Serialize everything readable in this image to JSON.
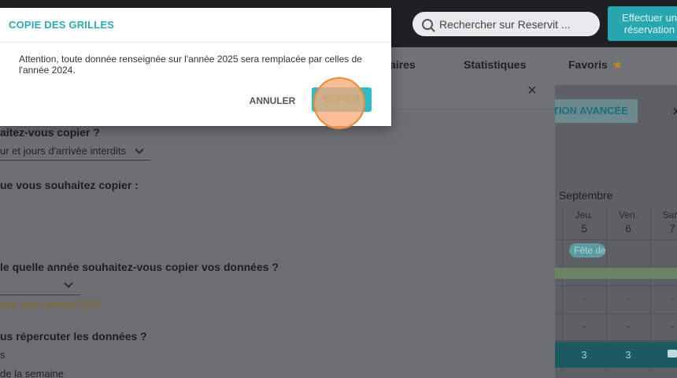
{
  "topbar": {
    "search_placeholder": "Rechercher sur Reservit ...",
    "reserve_label_line1": "Effectuer un",
    "reserve_label_line2": "réservation"
  },
  "nav": {
    "tab_tarifs": "aires",
    "tab_stats": "Statistiques",
    "tab_favoris": "Favoris",
    "star": "★"
  },
  "calendar": {
    "advanced_search": "TION AVANCÉE",
    "month": "Septembre",
    "days": [
      {
        "name": "Jeu.",
        "num": "5"
      },
      {
        "name": "Ven.",
        "num": "6"
      },
      {
        "name": "Sam",
        "num": "7"
      }
    ],
    "event": "Fête de",
    "dash": "-",
    "row_values": [
      "3",
      "3"
    ]
  },
  "main_dialog": {
    "close": "×",
    "q1": "aitez-vous copier ?",
    "a1": "ur et jours d'arrivée interdits",
    "q2": "ue vous souhaitez copier :",
    "q3": "le quelle année souhaitez-vous copier vos données ?",
    "note": "ées pour l'année 2025",
    "q4": "us répercuter les données ?",
    "a4a": "s",
    "a4b": "de la semaine"
  },
  "modal": {
    "title": "COPIE DES GRILLES",
    "text": "Attention, toute donnée renseignée sur l'année 2025 sera remplacée par celles de l'année 2024.",
    "cancel_label": "ANNULER",
    "copy_label": "COPIER",
    "accent_color": "#2ebac6"
  }
}
